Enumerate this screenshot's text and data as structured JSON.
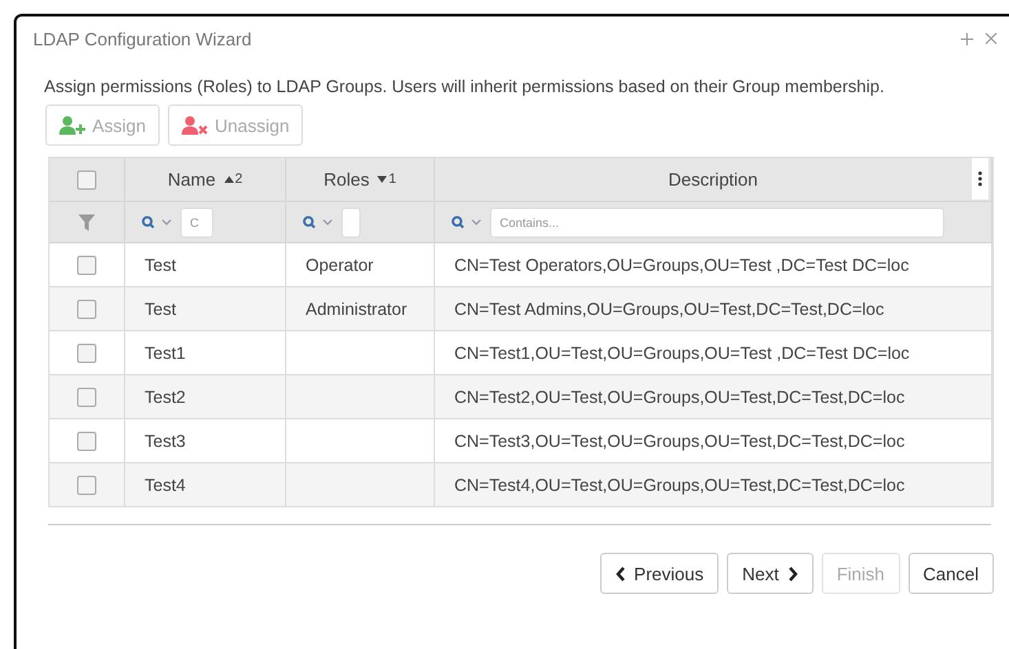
{
  "window": {
    "title": "LDAP Configuration Wizard"
  },
  "intro": "Assign permissions (Roles) to LDAP Groups. Users will inherit permissions based on their Group membership.",
  "toolbar": [
    {
      "kind": "assign",
      "label": "Assign",
      "disabled": true
    },
    {
      "kind": "unassign",
      "label": "Unassign",
      "disabled": true
    }
  ],
  "table": {
    "select_all": {
      "checked": false
    },
    "columns": [
      {
        "label": "Name",
        "sort_ascending": true,
        "sort_order": "2",
        "filter_placeholder": "C"
      },
      {
        "label": "Roles",
        "sort_ascending": false,
        "sort_order": "1"
      },
      {
        "label": "Description",
        "filter_placeholder": "Contains..."
      }
    ],
    "rows": [
      {
        "checked": false,
        "cells": [
          "Test",
          "Operator",
          "CN=Test Operators,OU=Groups,OU=Test ,DC=Test DC=loc"
        ]
      },
      {
        "checked": false,
        "cells": [
          "Test",
          "Administrator",
          "CN=Test Admins,OU=Groups,OU=Test,DC=Test,DC=loc"
        ]
      },
      {
        "checked": false,
        "cells": [
          "Test1",
          "",
          "CN=Test1,OU=Test,OU=Groups,OU=Test ,DC=Test DC=loc"
        ]
      },
      {
        "checked": false,
        "cells": [
          "Test2",
          "",
          "CN=Test2,OU=Test,OU=Groups,OU=Test,DC=Test,DC=loc"
        ]
      },
      {
        "checked": false,
        "cells": [
          "Test3",
          "",
          "CN=Test3,OU=Test,OU=Groups,OU=Test,DC=Test,DC=loc"
        ]
      },
      {
        "checked": false,
        "cells": [
          "Test4",
          "",
          "CN=Test4,OU=Test,OU=Groups,OU=Test,DC=Test,DC=loc"
        ]
      }
    ]
  },
  "footer": [
    {
      "kind": "previous",
      "label": "Previous",
      "disabled": false
    },
    {
      "kind": "next",
      "label": "Next",
      "disabled": false
    },
    {
      "kind": "plain",
      "label": "Finish",
      "disabled": true
    },
    {
      "kind": "plain",
      "label": "Cancel",
      "disabled": false
    }
  ]
}
